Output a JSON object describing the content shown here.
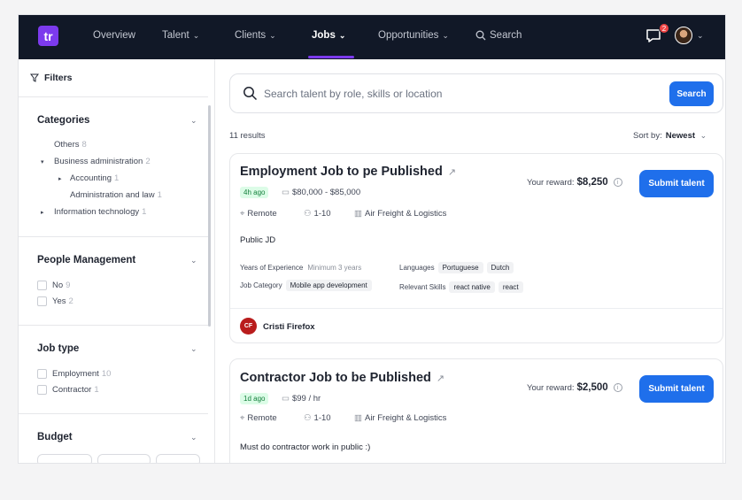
{
  "nav": {
    "logo": "tr",
    "items": [
      {
        "label": "Overview"
      },
      {
        "label": "Talent"
      },
      {
        "label": "Clients"
      },
      {
        "label": "Jobs"
      },
      {
        "label": "Opportunities"
      },
      {
        "label": "Search"
      }
    ],
    "notification_count": "2",
    "accent": "#7c3aed"
  },
  "sidebar": {
    "filters_label": "Filters",
    "categories": {
      "title": "Categories",
      "items": [
        {
          "label": "Others",
          "count": "8"
        },
        {
          "label": "Business administration",
          "count": "2"
        },
        {
          "label": "Accounting",
          "count": "1"
        },
        {
          "label": "Administration and law",
          "count": "1"
        },
        {
          "label": "Information technology",
          "count": "1"
        }
      ]
    },
    "people_management": {
      "title": "People Management",
      "options": [
        {
          "label": "No",
          "count": "9"
        },
        {
          "label": "Yes",
          "count": "2"
        }
      ]
    },
    "job_type": {
      "title": "Job type",
      "options": [
        {
          "label": "Employment",
          "count": "10"
        },
        {
          "label": "Contractor",
          "count": "1"
        }
      ]
    },
    "budget": {
      "title": "Budget"
    }
  },
  "search": {
    "placeholder": "Search talent by role, skills or location",
    "button": "Search"
  },
  "results": {
    "count_label": "11 results",
    "sort_label": "Sort by:",
    "sort_value": "Newest"
  },
  "jobs": [
    {
      "title": "Employment Job to pe Published",
      "ago": "4h ago",
      "rate": "$80,000 - $85,000",
      "location": "Remote",
      "team_size": "1-10",
      "industry": "Air Freight & Logistics",
      "reward_label": "Your reward:",
      "reward": "$8,250",
      "submit": "Submit talent",
      "description": "Public JD",
      "years_label": "Years of Experience",
      "years_value": "Minimum 3 years",
      "languages_label": "Languages",
      "languages": [
        "Portuguese",
        "Dutch"
      ],
      "category_label": "Job Category",
      "category": "Mobile app development",
      "skills_label": "Relevant Skills",
      "skills": [
        "react native",
        "react"
      ],
      "client_initials": "CF",
      "client_name": "Cristi Firefox"
    },
    {
      "title": "Contractor Job to be Published",
      "ago": "1d ago",
      "rate": "$99 / hr",
      "location": "Remote",
      "team_size": "1-10",
      "industry": "Air Freight & Logistics",
      "reward_label": "Your reward:",
      "reward": "$2,500",
      "submit": "Submit talent",
      "description": "Must do contractor work in public :)"
    }
  ],
  "colors": {
    "nav_bg": "#111827",
    "primary_button": "#1f6feb",
    "badge_green_bg": "#dcfce7",
    "client_avatar": "#b91c1c"
  }
}
